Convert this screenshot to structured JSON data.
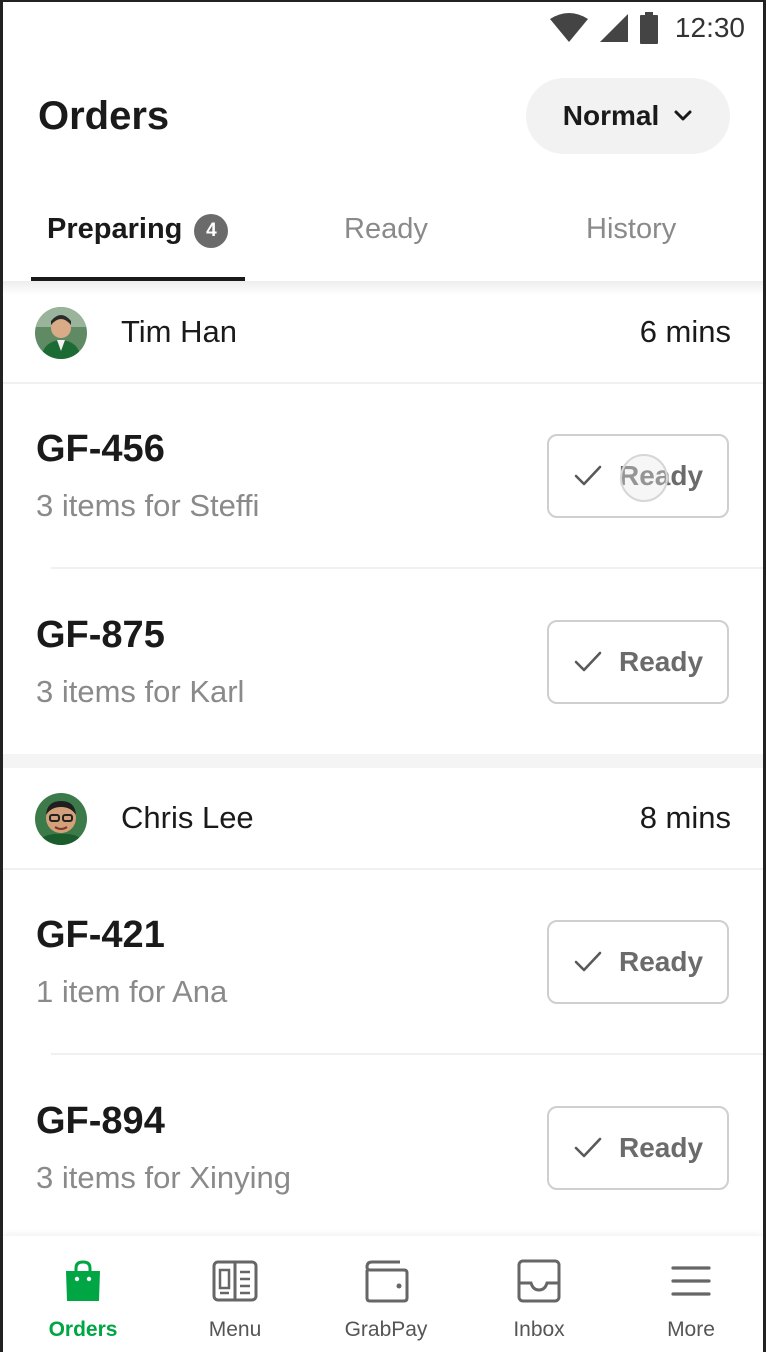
{
  "status_bar": {
    "time": "12:30"
  },
  "header": {
    "title": "Orders",
    "mode_select": {
      "value": "Normal"
    }
  },
  "tabs": [
    {
      "label": "Preparing",
      "badge": "4",
      "active": true
    },
    {
      "label": "Ready",
      "active": false
    },
    {
      "label": "History",
      "active": false
    }
  ],
  "groups": [
    {
      "customer": "Tim Han",
      "wait": "6 mins",
      "orders": [
        {
          "id": "GF-456",
          "desc": "3 items for Steffi",
          "button": "Ready"
        },
        {
          "id": "GF-875",
          "desc": "3 items for Karl",
          "button": "Ready"
        }
      ]
    },
    {
      "customer": "Chris Lee",
      "wait": "8 mins",
      "orders": [
        {
          "id": "GF-421",
          "desc": "1 item for Ana",
          "button": "Ready"
        },
        {
          "id": "GF-894",
          "desc": "3 items for Xinying",
          "button": "Ready"
        }
      ]
    }
  ],
  "bottom_nav": [
    {
      "label": "Orders",
      "icon": "shopping-bag-icon",
      "active": true
    },
    {
      "label": "Menu",
      "icon": "menu-book-icon",
      "active": false
    },
    {
      "label": "GrabPay",
      "icon": "wallet-icon",
      "active": false
    },
    {
      "label": "Inbox",
      "icon": "inbox-icon",
      "active": false
    },
    {
      "label": "More",
      "icon": "hamburger-icon",
      "active": false
    }
  ],
  "colors": {
    "brand_green": "#00a644",
    "text_primary": "#1a1a1a",
    "text_secondary": "#8a8a8a"
  }
}
